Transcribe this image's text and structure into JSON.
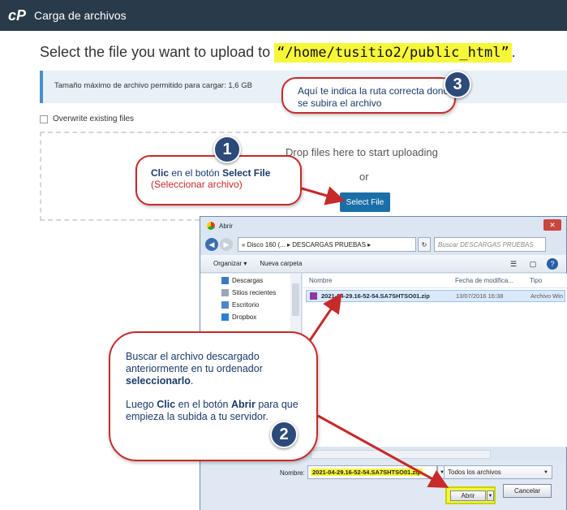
{
  "header": {
    "logo": "cP",
    "title": "Carga de archivos"
  },
  "upload": {
    "heading_prefix": "Select the file you want to upload to ",
    "path": "“/home/tusitio2/public_html”",
    "heading_suffix": ".",
    "max_size_text": "Tamaño máximo de archivo permitido para cargar: 1,6 GB",
    "overwrite_label": "Overwrite existing files",
    "drop_text": "Drop files here to start uploading",
    "or_text": "or",
    "select_file_label": "Select File"
  },
  "callouts": {
    "c1": {
      "number": "1",
      "clic": "Clic",
      "mid": " en el botón ",
      "btn": "Select File",
      "sub": "(Seleccionar archivo)"
    },
    "c2": {
      "number": "2",
      "p1a": "Buscar el archivo descargado anteriormente en tu ordenador ",
      "p1b": "seleccionarlo",
      "p1c": ".",
      "p2a": "Luego ",
      "p2b": "Clic",
      "p2c": " en el botón ",
      "p2d": "Abrir",
      "p2e": " para que empieza la subida a tu servidor."
    },
    "c3": {
      "number": "3",
      "text": "Aquí te indica la ruta correcta donde se subira el archivo"
    }
  },
  "dialog": {
    "title": "Abrir",
    "close": "✕",
    "address": "«  Disco 160 (...  ▸  DESCARGAS PRUEBAS  ▸",
    "search_placeholder": "Buscar DESCARGAS PRUEBAS",
    "organize": "Organizar ▾",
    "new_folder": "Nueva carpeta",
    "nav": [
      "Descargas",
      "Sitios recientes",
      "Escritorio",
      "Dropbox"
    ],
    "columns": {
      "name": "Nombre",
      "date": "Fecha de modifica...",
      "type": "Tipo"
    },
    "file": {
      "name": "2021-04-29.16-52-54.SA7SHTSO01.zip",
      "date": "13/07/2016 16:38",
      "type": "Archivo WinZip"
    },
    "name_label": "Nombre:",
    "name_value": "2021-04-29.16-52-54.SA7SHTSO01.zip",
    "filter": "Todos los archivos",
    "open": "Abrir",
    "cancel": "Cancelar"
  },
  "colors": {
    "accent": "#c62a2a",
    "highlight": "#f7f73a",
    "primary_button": "#1a6fa8",
    "badge": "#2c4a7a"
  }
}
